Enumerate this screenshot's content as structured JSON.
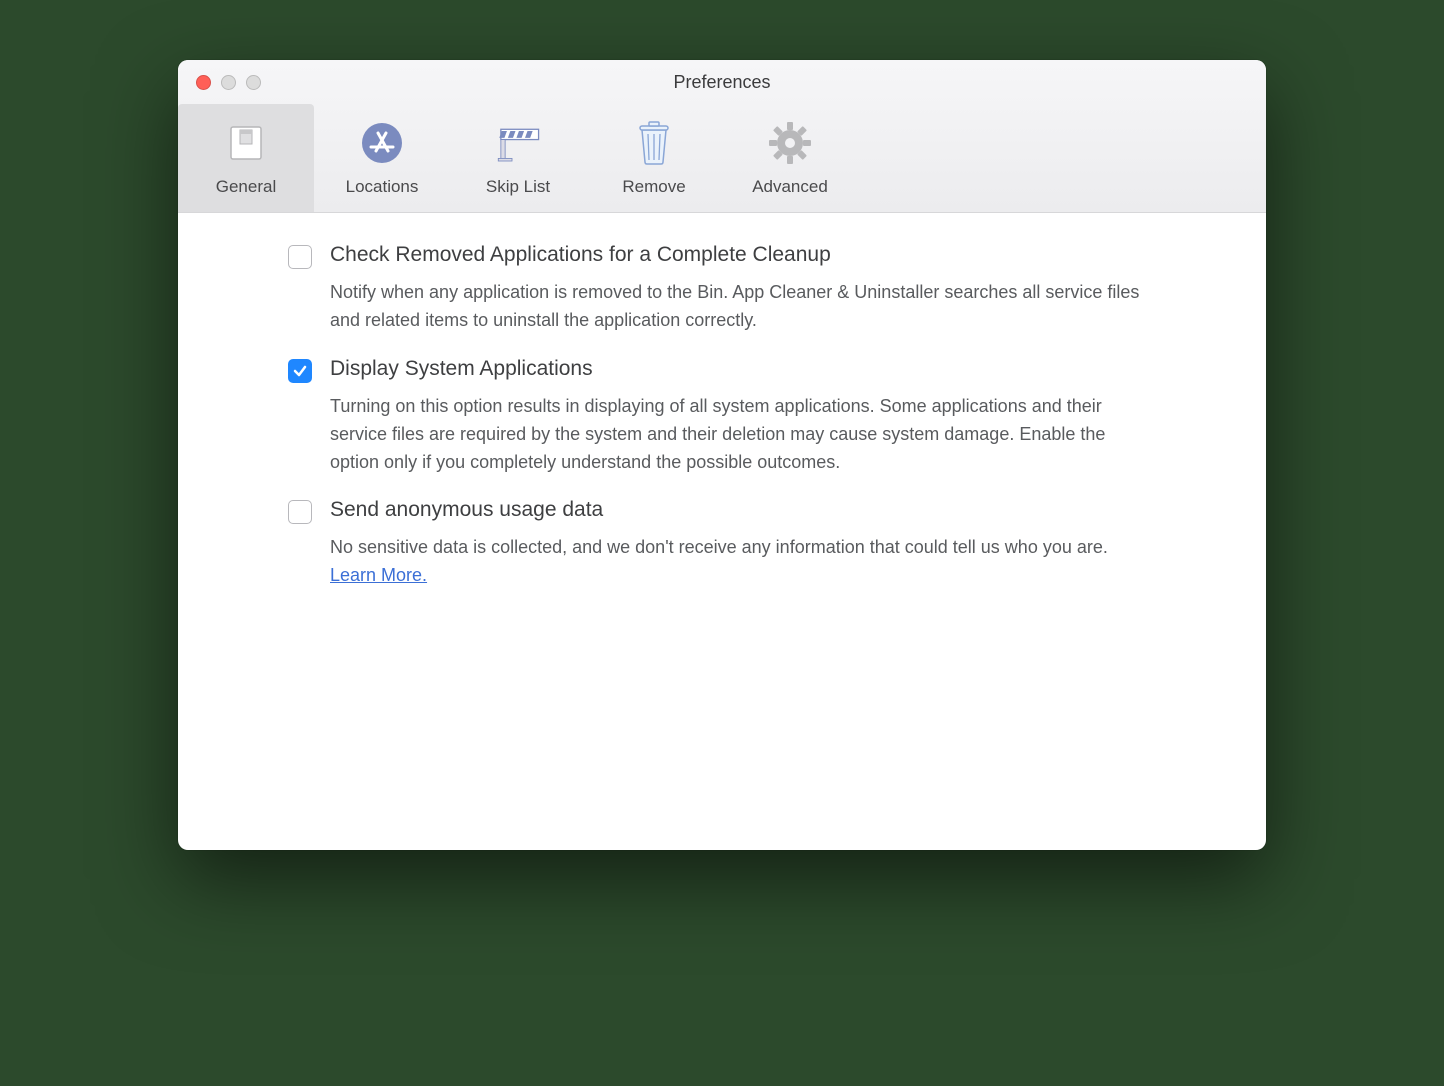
{
  "window": {
    "title": "Preferences"
  },
  "tabs": [
    {
      "label": "General"
    },
    {
      "label": "Locations"
    },
    {
      "label": "Skip List"
    },
    {
      "label": "Remove"
    },
    {
      "label": "Advanced"
    }
  ],
  "options": [
    {
      "title": "Check Removed Applications for a Complete Cleanup",
      "desc": "Notify when any application is removed to the Bin. App Cleaner & Uninstaller searches all service files and related items to uninstall the application correctly.",
      "checked": false
    },
    {
      "title": "Display System Applications",
      "desc": "Turning on this option results in displaying of all system applications. Some applications and their service files are required by the system and their deletion may cause system damage. Enable the option only if you completely understand the possible outcomes.",
      "checked": true
    },
    {
      "title": "Send anonymous usage data",
      "desc": "No sensitive data is collected, and we don't receive any information that could tell us who you are.   ",
      "checked": false,
      "link": "Learn More."
    }
  ]
}
